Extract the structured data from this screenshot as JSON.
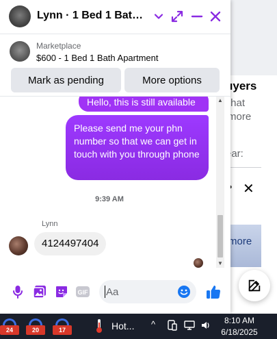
{
  "chat": {
    "title": "Lynn · 1 Bed 1 Bath Ap...",
    "listing": {
      "source": "Marketplace",
      "title": "$600 - 1 Bed 1 Bath Apartment",
      "mark_pending_label": "Mark as pending",
      "more_options_label": "More options"
    },
    "messages": {
      "outgoing_partial": "Hello, this is still available",
      "outgoing": "Please send me your phn number so that we can get in touch with you through phone",
      "timestamp": "9:39 AM",
      "sender_name": "Lynn",
      "incoming": "4124497404"
    },
    "composer": {
      "placeholder": "Aa"
    },
    "accent_color": "#a033ff",
    "icons": [
      "microphone-icon",
      "image-icon",
      "sticker-icon",
      "gif-icon",
      "emoji-icon",
      "thumbs-up-icon",
      "chevron-down-icon",
      "expand-icon",
      "minimize-icon",
      "close-icon"
    ]
  },
  "background_page": {
    "heading_fragment": "uyers",
    "line1": "that",
    "line2": "more",
    "line3": "ear:",
    "link": "more"
  },
  "taskbar": {
    "badges": [
      "24",
      "20",
      "17"
    ],
    "weather": "Hot...",
    "time": "8:10 AM",
    "date": "6/18/2025"
  }
}
